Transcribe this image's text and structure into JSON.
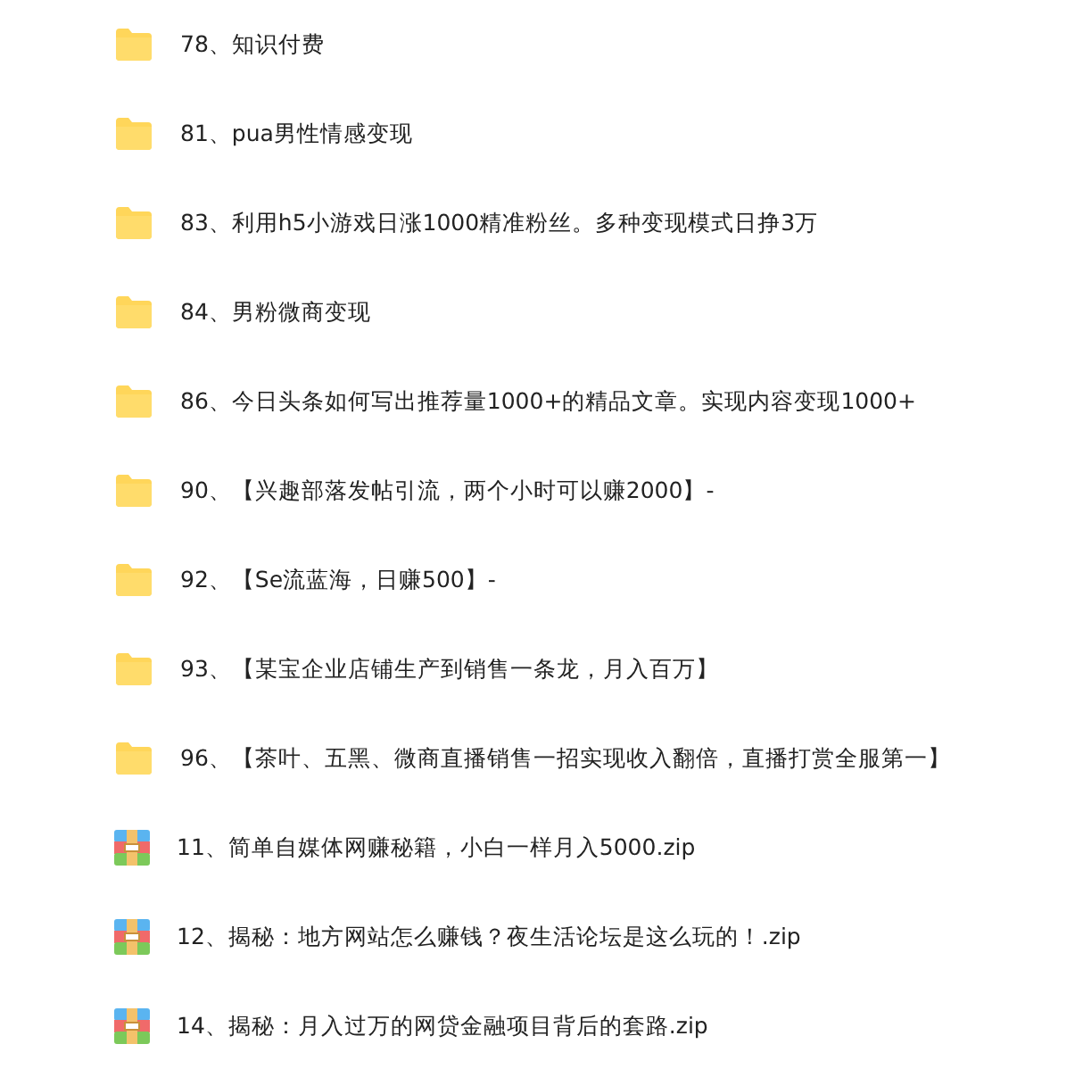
{
  "files": [
    {
      "kind": "folder",
      "name": "78、知识付费"
    },
    {
      "kind": "folder",
      "name": "81、pua男性情感变现"
    },
    {
      "kind": "folder",
      "name": "83、利用h5小游戏日涨1000精准粉丝。多种变现模式日挣3万"
    },
    {
      "kind": "folder",
      "name": "84、男粉微商变现"
    },
    {
      "kind": "folder",
      "name": "86、今日头条如何写出推荐量1000+的精品文章。实现内容变现1000+"
    },
    {
      "kind": "folder",
      "name": "90、【兴趣部落发帖引流，两个小时可以赚2000】-"
    },
    {
      "kind": "folder",
      "name": "92、【Se流蓝海，日赚500】-"
    },
    {
      "kind": "folder",
      "name": "93、【某宝企业店铺生产到销售一条龙，月入百万】"
    },
    {
      "kind": "folder",
      "name": "96、【茶叶、五黑、微商直播销售一招实现收入翻倍，直播打赏全服第一】"
    },
    {
      "kind": "zip",
      "name": "11、简单自媒体网赚秘籍，小白一样月入5000.zip"
    },
    {
      "kind": "zip",
      "name": "12、揭秘：地方网站怎么赚钱？夜生活论坛是这么玩的！.zip"
    },
    {
      "kind": "zip",
      "name": "14、揭秘：月入过万的网贷金融项目背后的套路.zip"
    }
  ]
}
